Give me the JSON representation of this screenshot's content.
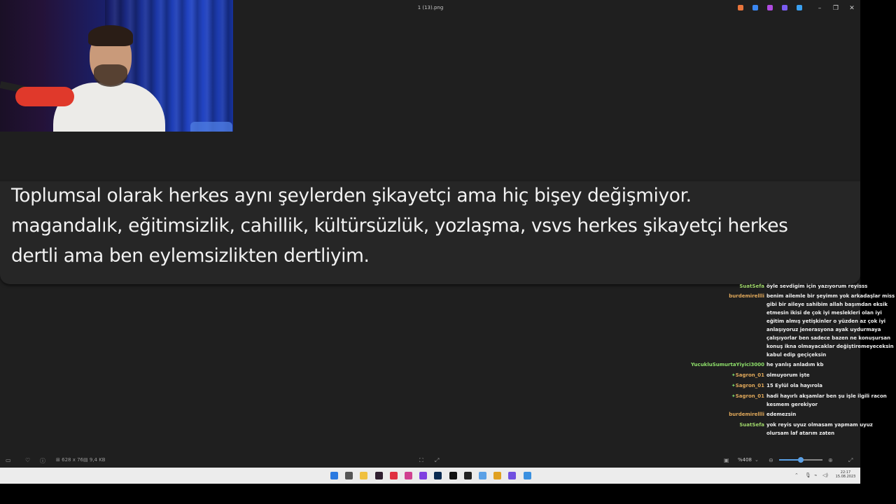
{
  "window": {
    "filename": "1 (13).png",
    "controls": {
      "minimize": "–",
      "maximize": "❐",
      "close": "✕"
    }
  },
  "titlebar_apps": [
    {
      "name": "copilot",
      "color": "#e8743b"
    },
    {
      "name": "edit",
      "color": "#3a86f0"
    },
    {
      "name": "clipchamp",
      "color": "#b04be0"
    },
    {
      "name": "designer",
      "color": "#7a5cf0"
    },
    {
      "name": "onedrive",
      "color": "#3aa0f0"
    }
  ],
  "message_image": {
    "lines": [
      "Toplumsal olarak herkes aynı şeylerden şikayetçi ama hiç bişey değişmiyor.",
      "magandalık, eğitimsizlik, cahillik, kültürsüzlük, yozlaşma, vsvs herkes şikayetçi herkes",
      "dertli ama ben  eylemsizlikten dertliyim."
    ]
  },
  "chat": [
    {
      "user": "SuatSefa",
      "color": "#9fd66a",
      "text": "öyle sevdigim için yazıyorum reyisss"
    },
    {
      "user": "burdemirellli",
      "color": "#e0a85a",
      "text": "benim ailemle bir şeyimm yok arkadaşlar miss gibi bir aileye sahibim allah başımdan eksik etmesin ikisi de çok iyi meslekleri olan iyi eğitim almış yetişkinler o yüzden az çok iyi anlaşıyoruz jenerasyona ayak uydurmaya çalışıyorlar ben sadece bazen ne konuşursan konuş ikna olmayacaklar değiştiremeyeceksin kabul edip geçiçeksin"
    },
    {
      "user": "YucukluSumurtaYiyici3000",
      "color": "#8ee06a",
      "text": "he yanlış anladım kb"
    },
    {
      "user": "Sagron_01",
      "color": "#e0a85a",
      "badge": "✦",
      "text": "olmuyorum işte"
    },
    {
      "user": "Sagron_01",
      "color": "#e0a85a",
      "badge": "✦",
      "text": "15 Eylül ola hayırola"
    },
    {
      "user": "Sagron_01",
      "color": "#e0a85a",
      "badge": "✦",
      "text": "hadi hayırlı akşamlar ben şu işle ilgili racon kesmem gerekiyor"
    },
    {
      "user": "burdemirellli",
      "color": "#e0a85a",
      "text": "edemezsin"
    },
    {
      "user": "SuatSefa",
      "color": "#9fd66a",
      "text": "yok reyis uyuz olmasam yapmam uyuz olursam laf atarım zaten"
    }
  ],
  "statusbar": {
    "dimensions": "628 x 76",
    "filesize": "9,4 KB",
    "zoom": "%408",
    "zoom_level": 0.5
  },
  "taskbar": {
    "time": "22:17",
    "date": "15.08.2023",
    "apps": [
      {
        "name": "start",
        "color": "#2a7ae0"
      },
      {
        "name": "task-view",
        "color": "#555555"
      },
      {
        "name": "file-explorer",
        "color": "#f0c040"
      },
      {
        "name": "obs",
        "color": "#302030"
      },
      {
        "name": "opera",
        "color": "#e03040"
      },
      {
        "name": "instagram",
        "color": "#d04090"
      },
      {
        "name": "twitch",
        "color": "#8040e0"
      },
      {
        "name": "photoshop",
        "color": "#0a2a50"
      },
      {
        "name": "tiktok",
        "color": "#111111"
      },
      {
        "name": "capcut",
        "color": "#222222"
      },
      {
        "name": "network",
        "color": "#5aa0e6"
      },
      {
        "name": "chrome",
        "color": "#e0a020"
      },
      {
        "name": "discord-app",
        "color": "#7050e0"
      },
      {
        "name": "photos",
        "color": "#3a90e0"
      }
    ]
  }
}
